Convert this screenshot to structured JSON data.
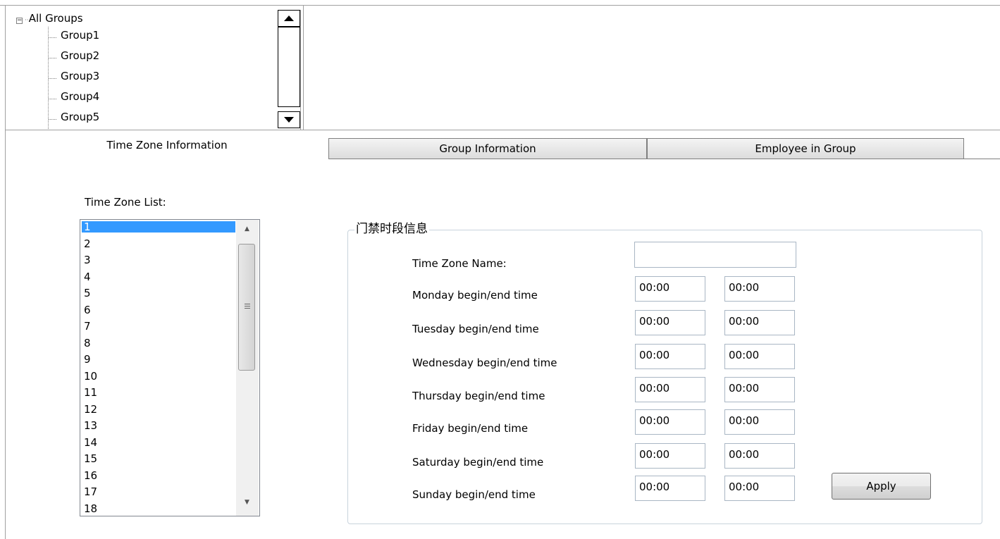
{
  "tree": {
    "root_label": "All Groups",
    "expander_symbol": "−",
    "items": [
      "Group1",
      "Group2",
      "Group3",
      "Group4",
      "Group5"
    ]
  },
  "tabs": [
    {
      "label": "Time Zone Information",
      "active": true
    },
    {
      "label": "Group Information",
      "active": false
    },
    {
      "label": "Employee in Group",
      "active": false
    }
  ],
  "time_zone_list": {
    "label": "Time Zone List:",
    "items": [
      "1",
      "2",
      "3",
      "4",
      "5",
      "6",
      "7",
      "8",
      "9",
      "10",
      "11",
      "12",
      "13",
      "14",
      "15",
      "16",
      "17",
      "18"
    ],
    "selected_index": 0
  },
  "group_box": {
    "title": "门禁时段信息",
    "name_label": "Time Zone Name:",
    "name_value": "",
    "rows": [
      {
        "label": "Monday begin/end time",
        "begin": "00:00",
        "end": "00:00"
      },
      {
        "label": "Tuesday begin/end time",
        "begin": "00:00",
        "end": "00:00"
      },
      {
        "label": "Wednesday begin/end time",
        "begin": "00:00",
        "end": "00:00"
      },
      {
        "label": "Thursday begin/end time",
        "begin": "00:00",
        "end": "00:00"
      },
      {
        "label": "Friday begin/end time",
        "begin": "00:00",
        "end": "00:00"
      },
      {
        "label": "Saturday begin/end time",
        "begin": "00:00",
        "end": "00:00"
      },
      {
        "label": "Sunday begin/end time",
        "begin": "00:00",
        "end": "00:00"
      }
    ],
    "apply_label": "Apply"
  },
  "colors": {
    "selection": "#3399ff",
    "border": "#a0a0a0",
    "groupbox_border": "#c8d3dc"
  }
}
